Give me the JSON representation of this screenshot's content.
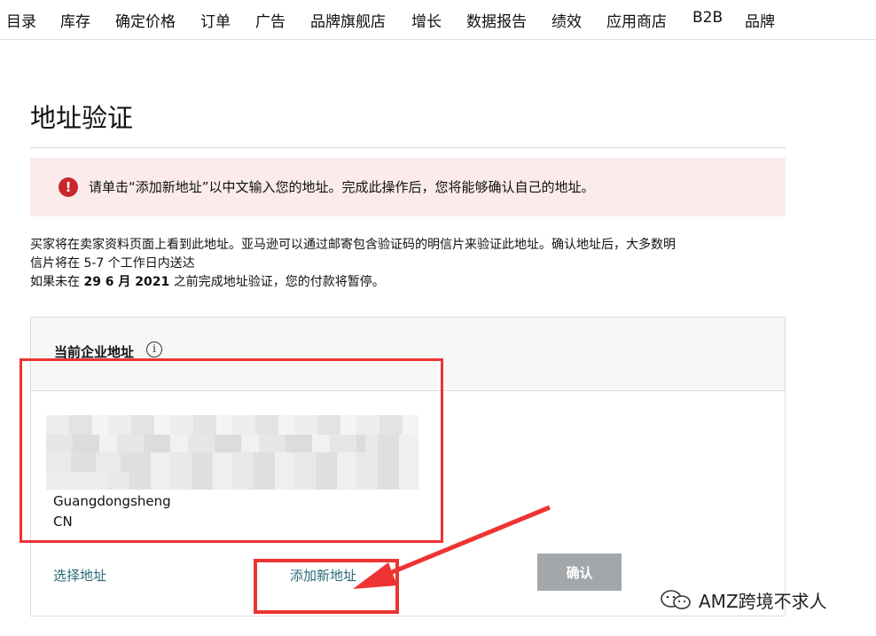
{
  "topnav": {
    "items": [
      "目录",
      "库存",
      "确定价格",
      "订单",
      "广告",
      "品牌旗舰店",
      "增长",
      "数据报告",
      "绩效",
      "应用商店",
      "B2B",
      "品牌"
    ]
  },
  "page": {
    "title": "地址验证"
  },
  "alert": {
    "icon": "!",
    "text": "请单击“添加新地址”以中文输入您的地址。完成此操作后，您将能够确认自己的地址。"
  },
  "info": {
    "line1": "买家将在卖家资料页面上看到此地址。亚马逊可以通过邮寄包含验证码的明信片来验证此地址。确认地址后，大多数明",
    "line2": "信片将在 5-7 个工作日内送达",
    "line3_prefix": "如果未在 ",
    "line3_date": "29 6 月 2021",
    "line3_suffix": " 之前完成地址验证，您的付款将暂停。"
  },
  "address_card": {
    "header_label": "当前企业地址",
    "info_icon": "i",
    "province": "Guangdongsheng",
    "country": "CN",
    "select_link": "选择地址",
    "add_link": "添加新地址",
    "confirm_button": "确认"
  },
  "watermark": {
    "text": "AMZ跨境不求人"
  },
  "colors": {
    "alert_bg": "#fbeceb",
    "alert_icon": "#c6282e",
    "link": "#2a6a78",
    "confirm_button": "#a3a7aa",
    "annotation": "#ee3333"
  }
}
